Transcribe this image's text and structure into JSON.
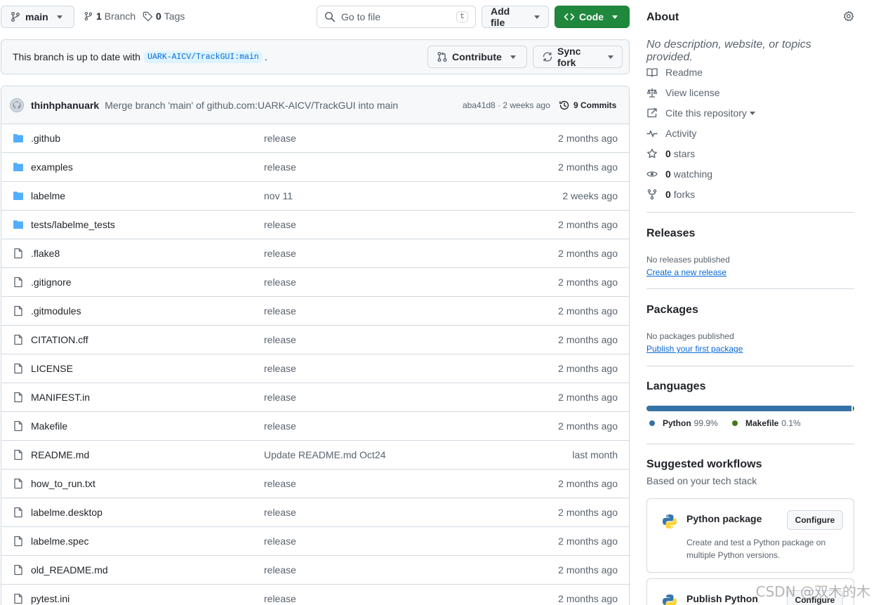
{
  "toolbar": {
    "branch": "main",
    "branches_count": "1",
    "branches_label": "Branch",
    "tags_count": "0",
    "tags_label": "Tags",
    "goto_placeholder": "Go to file",
    "goto_shortcut": "t",
    "add_file": "Add file",
    "code": "Code"
  },
  "banner": {
    "text_before": "This branch is up to date with",
    "ref": "UARK-AICV/TrackGUI:main",
    "text_after": ".",
    "contribute": "Contribute",
    "sync_fork": "Sync fork"
  },
  "latest_commit": {
    "author": "thinhphanuark",
    "message": "Merge branch 'main' of github.com:UARK-AICV/TrackGUI into main",
    "sha_time": "aba41d8 · 2 weeks ago",
    "commits": "9 Commits"
  },
  "files": [
    {
      "name": ".github",
      "type": "dir",
      "message": "release",
      "date": "2 months ago"
    },
    {
      "name": "examples",
      "type": "dir",
      "message": "release",
      "date": "2 months ago"
    },
    {
      "name": "labelme",
      "type": "dir",
      "message": "nov 11",
      "date": "2 weeks ago"
    },
    {
      "name": "tests/labelme_tests",
      "type": "dir",
      "message": "release",
      "date": "2 months ago"
    },
    {
      "name": ".flake8",
      "type": "file",
      "message": "release",
      "date": "2 months ago"
    },
    {
      "name": ".gitignore",
      "type": "file",
      "message": "release",
      "date": "2 months ago"
    },
    {
      "name": ".gitmodules",
      "type": "file",
      "message": "release",
      "date": "2 months ago"
    },
    {
      "name": "CITATION.cff",
      "type": "file",
      "message": "release",
      "date": "2 months ago"
    },
    {
      "name": "LICENSE",
      "type": "file",
      "message": "release",
      "date": "2 months ago"
    },
    {
      "name": "MANIFEST.in",
      "type": "file",
      "message": "release",
      "date": "2 months ago"
    },
    {
      "name": "Makefile",
      "type": "file",
      "message": "release",
      "date": "2 months ago"
    },
    {
      "name": "README.md",
      "type": "file",
      "message": "Update README.md Oct24",
      "date": "last month"
    },
    {
      "name": "how_to_run.txt",
      "type": "file",
      "message": "release",
      "date": "2 months ago"
    },
    {
      "name": "labelme.desktop",
      "type": "file",
      "message": "release",
      "date": "2 months ago"
    },
    {
      "name": "labelme.spec",
      "type": "file",
      "message": "release",
      "date": "2 months ago"
    },
    {
      "name": "old_README.md",
      "type": "file",
      "message": "release",
      "date": "2 months ago"
    },
    {
      "name": "pytest.ini",
      "type": "file",
      "message": "release",
      "date": "2 months ago"
    }
  ],
  "about": {
    "title": "About",
    "description": "No description, website, or topics provided.",
    "readme": "Readme",
    "license": "View license",
    "cite": "Cite this repository",
    "activity": "Activity",
    "stars_count": "0",
    "stars_label": "stars",
    "watching_count": "0",
    "watching_label": "watching",
    "forks_count": "0",
    "forks_label": "forks"
  },
  "releases": {
    "title": "Releases",
    "none": "No releases published",
    "create": "Create a new release"
  },
  "packages": {
    "title": "Packages",
    "none": "No packages published",
    "publish": "Publish your first package"
  },
  "languages": {
    "title": "Languages",
    "items": [
      {
        "name": "Python",
        "percent": "99.9%",
        "share": 99.9,
        "color": "#3572A5"
      },
      {
        "name": "Makefile",
        "percent": "0.1%",
        "share": 0.1,
        "color": "#427819"
      }
    ]
  },
  "workflows": {
    "title": "Suggested workflows",
    "subtitle": "Based on your tech stack",
    "items": [
      {
        "name": "Python package",
        "description": "Create and test a Python package on multiple Python versions.",
        "button": "Configure"
      },
      {
        "name": "Publish Python",
        "description": "",
        "button": "Configure"
      }
    ]
  },
  "watermark": "CSDN @双木的木",
  "colors": {
    "accent": "#0969da",
    "primary_button": "#1f883d",
    "folder_icon": "#54aeff"
  }
}
